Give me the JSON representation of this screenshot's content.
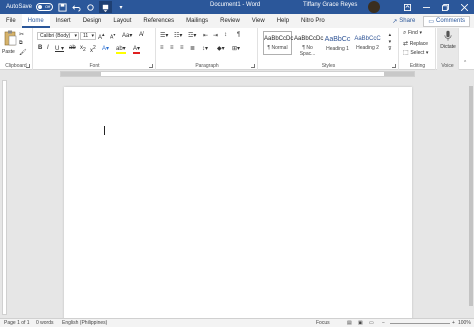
{
  "titlebar": {
    "autosave_label": "AutoSave",
    "autosave_state": "Off",
    "doc_title": "Document1 - Word",
    "user_name": "Tiffany Grace Reyes",
    "bg_color": "#2b579a"
  },
  "tabs": [
    "File",
    "Home",
    "Insert",
    "Design",
    "Layout",
    "References",
    "Mailings",
    "Review",
    "View",
    "Help",
    "Nitro Pro"
  ],
  "active_tab": "Home",
  "share_label": "Share",
  "comments_label": "Comments",
  "ribbon": {
    "clipboard": {
      "paste_label": "Paste",
      "group_label": "Clipboard"
    },
    "font": {
      "font_name": "Calibri (Body)",
      "font_size": "11",
      "group_label": "Font"
    },
    "paragraph": {
      "group_label": "Paragraph"
    },
    "styles": {
      "group_label": "Styles",
      "items": [
        {
          "preview": "AaBbCcDc",
          "name": "¶ Normal"
        },
        {
          "preview": "AaBbCcDc",
          "name": "¶ No Spac..."
        },
        {
          "preview": "AaBbCc",
          "name": "Heading 1"
        },
        {
          "preview": "AaBbCcC",
          "name": "Heading 2"
        }
      ]
    },
    "editing": {
      "group_label": "Editing",
      "find_label": "Find",
      "replace_label": "Replace",
      "select_label": "Select"
    },
    "voice": {
      "dictate_label": "Dictate",
      "group_label": "Voice"
    }
  },
  "status": {
    "page": "Page 1 of 1",
    "words": "0 words",
    "language": "English (Philippines)",
    "focus": "Focus",
    "zoom": "100%"
  }
}
